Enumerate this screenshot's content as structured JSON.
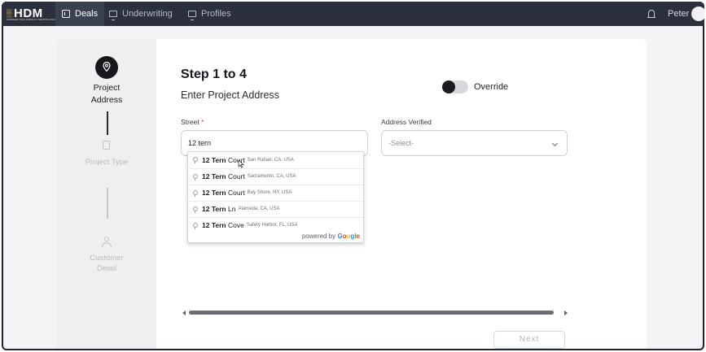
{
  "app": {
    "logo_text": "HDM",
    "logo_subtext": "HOMEBUYER DIRECT MORTGAGE"
  },
  "nav": {
    "items": [
      {
        "label": "Deals",
        "icon": "book-icon",
        "active": true
      },
      {
        "label": "Underwriting",
        "icon": "monitor-icon",
        "active": false
      },
      {
        "label": "Profiles",
        "icon": "monitor-icon",
        "active": false
      }
    ],
    "user_name": "Peter"
  },
  "stepper": {
    "steps": [
      {
        "label_line1": "Project",
        "label_line2": "Address",
        "icon": "map-pin-icon",
        "state": "active"
      },
      {
        "label_line1": "Project Type",
        "label_line2": "",
        "icon": "document-icon",
        "state": "inactive"
      },
      {
        "label_line1": "Customer",
        "label_line2": "Detail",
        "icon": "person-icon",
        "state": "inactive"
      }
    ]
  },
  "form": {
    "step_title": "Step 1 to 4",
    "step_subtitle": "Enter Project Address",
    "override_label": "Override",
    "override_on": false,
    "street_label": "Street",
    "street_required_mark": "*",
    "street_value": "12 tern",
    "address_verified_label": "Address Verified",
    "address_verified_placeholder": "-Select-",
    "next_label": "Next"
  },
  "autocomplete": {
    "suggestions": [
      {
        "bold": "12 Tern",
        "rest": " Court",
        "secondary": "San Rafael, CA, USA"
      },
      {
        "bold": "12 Tern",
        "rest": " Court",
        "secondary": "Sacramento, CA, USA"
      },
      {
        "bold": "12 Tern",
        "rest": " Court",
        "secondary": "Bay Shore, NY, USA"
      },
      {
        "bold": "12 Tern",
        "rest": " Ln",
        "secondary": "Alameda, CA, USA"
      },
      {
        "bold": "12 Tern",
        "rest": " Cove",
        "secondary": "Safety Harbor, FL, USA"
      }
    ],
    "powered_by": "powered by",
    "google_letters": [
      "G",
      "o",
      "o",
      "g",
      "l",
      "e"
    ]
  },
  "colors": {
    "topbar": "#2b303c",
    "frame": "#1f2430",
    "accent_dark": "#17181c",
    "required": "#e23b3b"
  }
}
